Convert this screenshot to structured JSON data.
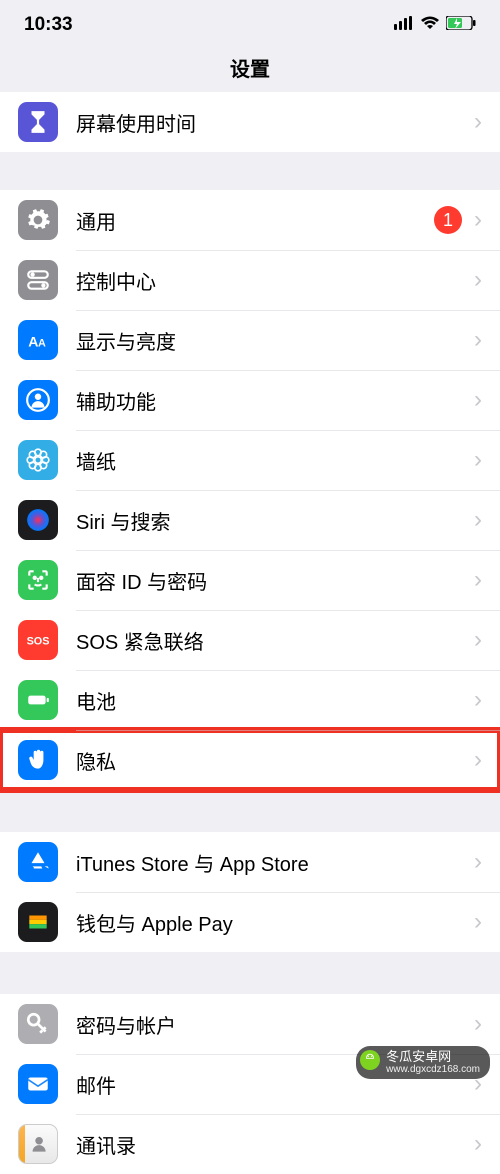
{
  "status": {
    "time": "10:33"
  },
  "title": "设置",
  "groups": [
    {
      "gap": 0,
      "rows": [
        {
          "id": "screen-time",
          "icon": "hourglass",
          "bg": "ic-purple",
          "label": "屏幕使用时间"
        }
      ]
    },
    {
      "gap": 38,
      "rows": [
        {
          "id": "general",
          "icon": "gear",
          "bg": "ic-gray",
          "label": "通用",
          "badge": "1"
        },
        {
          "id": "control-center",
          "icon": "switches",
          "bg": "ic-gray",
          "label": "控制中心"
        },
        {
          "id": "display",
          "icon": "aa",
          "bg": "ic-blue",
          "label": "显示与亮度"
        },
        {
          "id": "accessibility",
          "icon": "person",
          "bg": "ic-blue",
          "label": "辅助功能"
        },
        {
          "id": "wallpaper",
          "icon": "flower",
          "bg": "ic-cyan",
          "label": "墙纸"
        },
        {
          "id": "siri",
          "icon": "siri",
          "bg": "ic-dark",
          "label": "Siri 与搜索"
        },
        {
          "id": "faceid",
          "icon": "faceid",
          "bg": "ic-green",
          "label": "面容 ID 与密码"
        },
        {
          "id": "sos",
          "icon": "sos",
          "bg": "ic-red",
          "label": "SOS 紧急联络"
        },
        {
          "id": "battery",
          "icon": "battery",
          "bg": "ic-green",
          "label": "电池"
        },
        {
          "id": "privacy",
          "icon": "hand",
          "bg": "ic-blue",
          "label": "隐私",
          "highlight": true
        }
      ]
    },
    {
      "gap": 42,
      "rows": [
        {
          "id": "itunes",
          "icon": "appstore",
          "bg": "ic-blue",
          "label": "iTunes Store 与 App Store"
        },
        {
          "id": "wallet",
          "icon": "wallet",
          "bg": "ic-dark",
          "label": "钱包与 Apple Pay"
        }
      ]
    },
    {
      "gap": 42,
      "rows": [
        {
          "id": "passwords",
          "icon": "key",
          "bg": "ic-gray-l",
          "label": "密码与帐户"
        },
        {
          "id": "mail",
          "icon": "mail",
          "bg": "ic-blue",
          "label": "邮件"
        },
        {
          "id": "contacts",
          "icon": "contacts",
          "bg": "ic-contacts",
          "label": "通讯录"
        }
      ]
    }
  ],
  "watermark": {
    "name": "冬瓜安卓网",
    "url": "www.dgxcdz168.com"
  }
}
